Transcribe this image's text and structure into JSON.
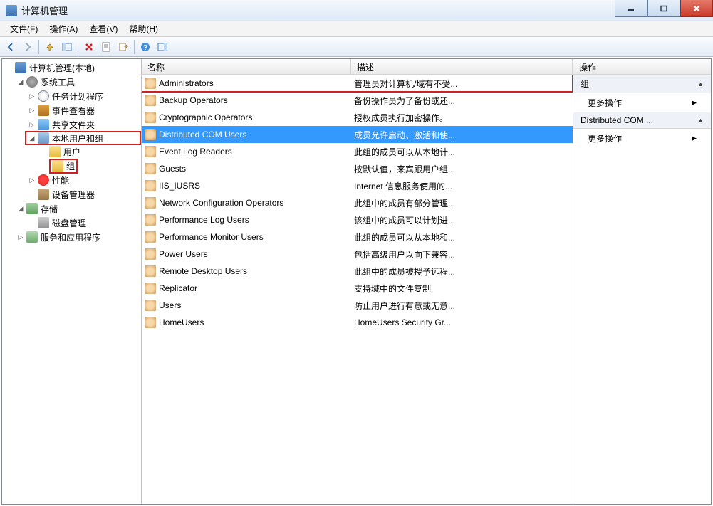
{
  "window": {
    "title": "计算机管理"
  },
  "menus": [
    "文件(F)",
    "操作(A)",
    "查看(V)",
    "帮助(H)"
  ],
  "tree": {
    "root": "计算机管理(本地)",
    "system_tools": "系统工具",
    "task_scheduler": "任务计划程序",
    "event_viewer": "事件查看器",
    "shared_folders": "共享文件夹",
    "local_users_groups": "本地用户和组",
    "users": "用户",
    "groups": "组",
    "performance": "性能",
    "device_manager": "设备管理器",
    "storage": "存储",
    "disk_management": "磁盘管理",
    "services_apps": "服务和应用程序"
  },
  "list_columns": {
    "name": "名称",
    "desc": "描述"
  },
  "groups": [
    {
      "name": "Administrators",
      "desc": "管理员对计算机/域有不受..."
    },
    {
      "name": "Backup Operators",
      "desc": "备份操作员为了备份或还..."
    },
    {
      "name": "Cryptographic Operators",
      "desc": "授权成员执行加密操作。"
    },
    {
      "name": "Distributed COM Users",
      "desc": "成员允许启动、激活和使..."
    },
    {
      "name": "Event Log Readers",
      "desc": "此组的成员可以从本地计..."
    },
    {
      "name": "Guests",
      "desc": "按默认值，来宾跟用户组..."
    },
    {
      "name": "IIS_IUSRS",
      "desc": "Internet 信息服务使用的..."
    },
    {
      "name": "Network Configuration Operators",
      "desc": "此组中的成员有部分管理..."
    },
    {
      "name": "Performance Log Users",
      "desc": "该组中的成员可以计划进..."
    },
    {
      "name": "Performance Monitor Users",
      "desc": "此组的成员可以从本地和..."
    },
    {
      "name": "Power Users",
      "desc": "包括高级用户以向下兼容..."
    },
    {
      "name": "Remote Desktop Users",
      "desc": "此组中的成员被授予远程..."
    },
    {
      "name": "Replicator",
      "desc": "支持域中的文件复制"
    },
    {
      "name": "Users",
      "desc": "防止用户进行有意或无意..."
    },
    {
      "name": "HomeUsers",
      "desc": "HomeUsers Security Gr..."
    }
  ],
  "actions": {
    "header": "操作",
    "section_groups": "组",
    "more_actions": "更多操作",
    "section_selected": "Distributed COM ..."
  }
}
